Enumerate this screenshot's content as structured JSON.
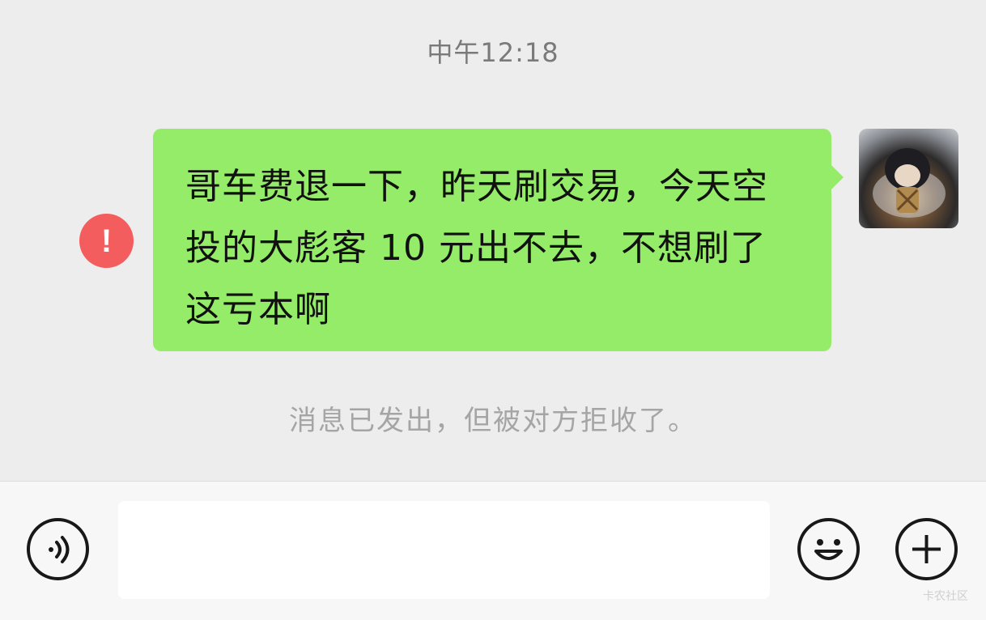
{
  "chat": {
    "timestamp": "中午12:18",
    "message": {
      "text": "哥车费退一下，昨天刷交易，今天空投的大彪客 10 元出不去，不想刷了这亏本啊",
      "status_icon": "exclamation-icon",
      "bubble_color": "#95ec69"
    },
    "system_notice": "消息已发出，但被对方拒收了。"
  },
  "input_bar": {
    "voice_icon": "voice-icon",
    "emoji_icon": "emoji-icon",
    "more_icon": "plus-icon",
    "input_value": "",
    "input_placeholder": ""
  },
  "error_color": "#f45d5d",
  "watermark": "卡农社区"
}
